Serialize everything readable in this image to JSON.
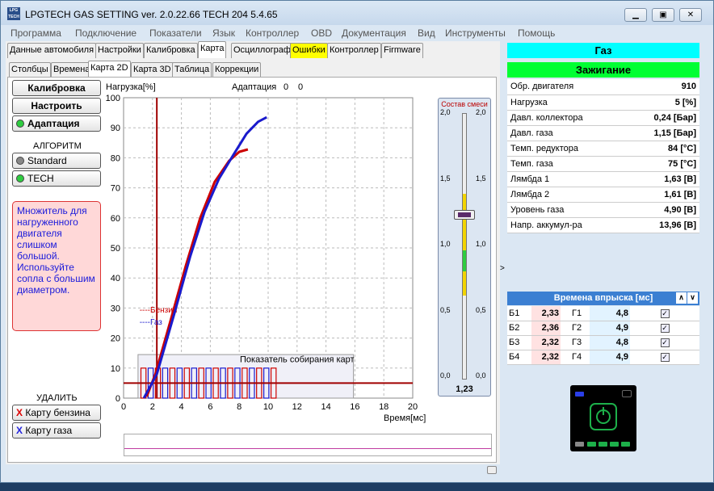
{
  "window": {
    "title": "LPGTECH GAS SETTING ver. 2.0.22.66   TECH 204   5.4.65",
    "logo": "LPG TECH",
    "controls": [
      "minimize",
      "restore",
      "close"
    ]
  },
  "menu": [
    "Программа",
    "Подключение",
    "Показатели",
    "Язык",
    "Контроллер",
    "OBD",
    "Документация",
    "Вид",
    "Инструменты",
    "Помощь"
  ],
  "tabs_main": [
    "Данные автомобиля",
    "Настройки",
    "Калибровка",
    "Карта",
    "Осциллограф",
    "Ошибки",
    "Контроллер",
    "Firmware"
  ],
  "tabs_sub": [
    "Столбцы",
    "Времена",
    "Карта 2D",
    "Карта 3D",
    "Таблица",
    "Коррекции"
  ],
  "left": {
    "calib": "Калибровка",
    "tune": "Настроить",
    "adapt": "Адаптация",
    "algo_title": "АЛГОРИТМ",
    "algo_standard": "Standard",
    "algo_tech": "TECH",
    "note": "Множитель для нагруженного двигателя слишком большой. Используйте сопла с большим диаметром.",
    "delete_title": "УДАЛИТЬ",
    "del_petrol": "Карту бензина",
    "del_gas": "Карту газа",
    "del_mark": "X"
  },
  "chart_header": {
    "load": "Нагрузка[%]",
    "adapt": "Адаптация",
    "adapt_a": "0",
    "adapt_b": "0"
  },
  "chart_data": {
    "type": "line",
    "xlabel": "Время[мс]",
    "ylabel": "Нагрузка[%]",
    "xlim": [
      0,
      20
    ],
    "ylim": [
      0,
      100
    ],
    "xticks": [
      "0",
      "2",
      "4",
      "6",
      "8",
      "10",
      "12",
      "14",
      "16",
      "18",
      "20"
    ],
    "yticks": [
      "0",
      "10",
      "20",
      "30",
      "40",
      "50",
      "60",
      "70",
      "80",
      "90",
      "100"
    ],
    "legend": [
      "----Бензин",
      "----Газ"
    ],
    "marker_x": 2.3,
    "hline_y": 5,
    "maps_label": "Показатель собирания карт",
    "series": [
      {
        "name": "Бензин",
        "color": "#cc0000",
        "points": [
          [
            1.6,
            0.5
          ],
          [
            2.2,
            8
          ],
          [
            3.2,
            25
          ],
          [
            4.3,
            44
          ],
          [
            5.3,
            60
          ],
          [
            6.3,
            72
          ],
          [
            7.3,
            79
          ],
          [
            8.0,
            82
          ],
          [
            8.6,
            82.8
          ]
        ]
      },
      {
        "name": "Газ",
        "color": "#1a1acc",
        "points": [
          [
            1.4,
            0
          ],
          [
            2.3,
            8
          ],
          [
            3.5,
            28
          ],
          [
            4.6,
            47
          ],
          [
            5.6,
            62
          ],
          [
            6.6,
            73
          ],
          [
            7.6,
            81
          ],
          [
            8.5,
            88
          ],
          [
            9.3,
            92
          ],
          [
            9.9,
            93.5
          ]
        ]
      }
    ]
  },
  "mixture": {
    "title": "Состав смеси",
    "ticks": [
      "2,0",
      "1,5",
      "1,0",
      "0,5",
      "0,0"
    ],
    "value": "1,23"
  },
  "params": {
    "title_gas": "Газ",
    "title_ign": "Зажигание",
    "rows": [
      [
        "Обр. двигателя",
        "910"
      ],
      [
        "Нагрузка",
        "5 [%]"
      ],
      [
        "Давл. коллектора",
        "0,24 [Бар]"
      ],
      [
        "Давл. газа",
        "1,15 [Бар]"
      ],
      [
        "Темп. редуктора",
        "84 [°C]"
      ],
      [
        "Темп. газа",
        "75 [°C]"
      ],
      [
        "Лямбда 1",
        "1,63 [В]"
      ],
      [
        "Лямбда 2",
        "1,61 [В]"
      ],
      [
        "Уровень газа",
        "4,90 [В]"
      ],
      [
        "Напр. аккумул-ра",
        "13,96 [В]"
      ]
    ]
  },
  "injection": {
    "title": "Времена впрыска [мс]",
    "rows": [
      [
        "Б1",
        "2,33",
        "Г1",
        "4,8"
      ],
      [
        "Б2",
        "2,36",
        "Г2",
        "4,9"
      ],
      [
        "Б3",
        "2,32",
        "Г3",
        "4,8"
      ],
      [
        "Б4",
        "2,32",
        "Г4",
        "4,9"
      ]
    ]
  },
  "colors": {
    "cyan": "#00ffff",
    "green": "#00ff33",
    "accent": "#3b7fd2"
  }
}
